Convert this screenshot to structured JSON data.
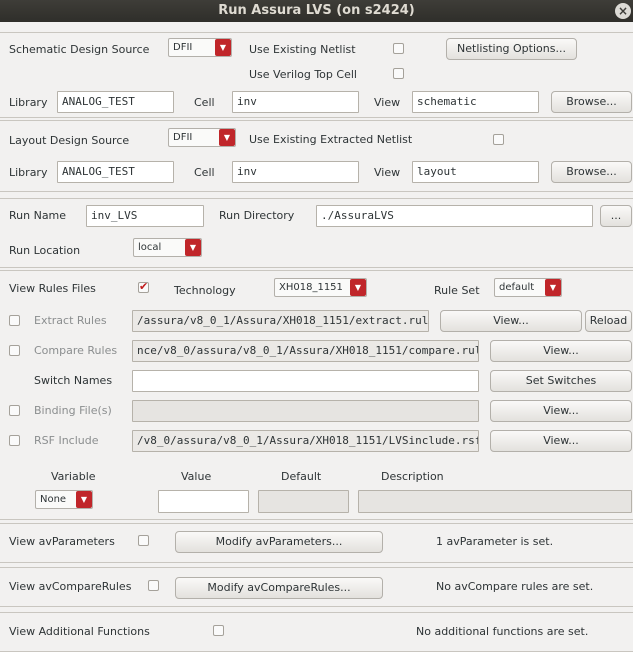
{
  "window": {
    "title": "Run Assura LVS (on s2424)"
  },
  "schematic": {
    "source_label": "Schematic Design Source",
    "source_value": "DFII",
    "use_existing_netlist": "Use Existing Netlist",
    "use_verilog_top_cell": "Use Verilog Top Cell",
    "netlisting_options": "Netlisting Options...",
    "library_label": "Library",
    "library_value": "ANALOG_TEST",
    "cell_label": "Cell",
    "cell_value": "inv",
    "view_label": "View",
    "view_value": "schematic",
    "browse": "Browse..."
  },
  "layout": {
    "source_label": "Layout Design Source",
    "source_value": "DFII",
    "use_existing_extracted": "Use Existing Extracted Netlist",
    "library_label": "Library",
    "library_value": "ANALOG_TEST",
    "cell_label": "Cell",
    "cell_value": "inv",
    "view_label": "View",
    "view_value": "layout",
    "browse": "Browse..."
  },
  "run": {
    "name_label": "Run Name",
    "name_value": "inv_LVS",
    "dir_label": "Run Directory",
    "dir_value": "./AssuraLVS",
    "dir_browse": "...",
    "location_label": "Run Location",
    "location_value": "local"
  },
  "rules": {
    "view_rules_files": "View Rules Files",
    "view_rules_checked": true,
    "technology_label": "Technology",
    "technology_value": "XH018_1151",
    "rule_set_label": "Rule Set",
    "rule_set_value": "default",
    "extract_label": "Extract Rules",
    "extract_value": "/assura/v8_0_1/Assura/XH018_1151/extract.rul",
    "compare_label": "Compare Rules",
    "compare_value": "nce/v8_0/assura/v8_0_1/Assura/XH018_1151/compare.rul",
    "switch_label": "Switch Names",
    "switch_value": "",
    "binding_label": "Binding File(s)",
    "binding_value": "",
    "rsf_label": "RSF Include",
    "rsf_value": "/v8_0/assura/v8_0_1/Assura/XH018_1151/LVSinclude.rsf",
    "view_btn": "View...",
    "reload_btn": "Reload",
    "set_switches_btn": "Set Switches",
    "var_header": "Variable",
    "value_header": "Value",
    "default_header": "Default",
    "description_header": "Description",
    "variable_value": "None"
  },
  "av": {
    "view_params_label": "View avParameters",
    "modify_params_btn": "Modify avParameters...",
    "params_status": "1 avParameter is set.",
    "view_compare_label": "View avCompareRules",
    "modify_compare_btn": "Modify avCompareRules...",
    "compare_status": "No avCompare rules are set.",
    "view_additional_label": "View Additional Functions",
    "additional_status": "No additional functions are set."
  },
  "colors": {
    "accent_red": "#c0262a",
    "titlebar": "#3a3935"
  }
}
